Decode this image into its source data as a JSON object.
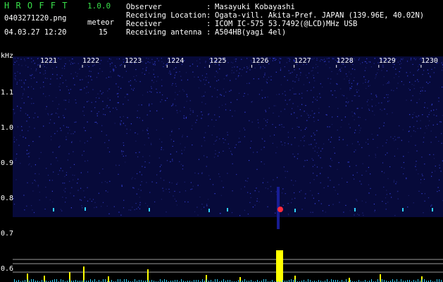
{
  "app": {
    "name": "H R O F F T",
    "version": "1.0.0"
  },
  "file": {
    "name": "0403271220.png",
    "datetime": "04.03.27 12:20"
  },
  "meteor": {
    "label": "meteor",
    "count": "15"
  },
  "info": [
    {
      "label": "Observer",
      "value": "Masayuki Kobayashi"
    },
    {
      "label": "Receiving Location",
      "value": "Ogata-vill. Akita-Pref. JAPAN (139.96E, 40.02N)"
    },
    {
      "label": "Receiver",
      "value": "ICOM IC-575 53.7492(@LCD)MHz USB"
    },
    {
      "label": "Receiving antenna",
      "value": "A504HB(yagi 4el)"
    }
  ],
  "axis": {
    "y_unit": "kHz",
    "y_ticks": [
      "1.1",
      "1.0",
      "0.9",
      "0.8",
      "0.7",
      "0.6"
    ],
    "x_ticks": [
      "1221",
      "1222",
      "1223",
      "1224",
      "1225",
      "1226",
      "1227",
      "1228",
      "1229",
      "1230"
    ]
  },
  "colors": {
    "background": "#000000",
    "noise": "#1a1fa0",
    "echo_strong": "#ff2a3c",
    "echo_cyan": "#2fd0ff",
    "level_bar": "#ffff00",
    "title_green": "#39e04a"
  }
}
